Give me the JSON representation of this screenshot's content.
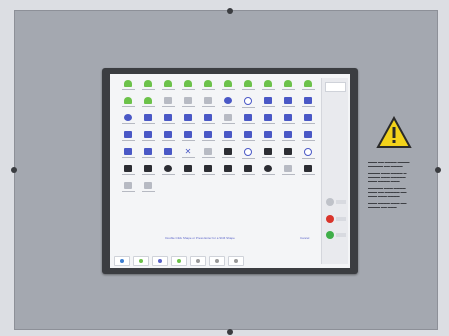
{
  "screen": {
    "hint_text": "Double Click Shape or Press Enter for a Shift Shape",
    "hint_right": "Cancel",
    "icon_rows": [
      [
        "g",
        "g",
        "g",
        "g",
        "g",
        "g",
        "g",
        "g",
        "g",
        "g"
      ],
      [
        "g",
        "g",
        "gy",
        "gy",
        "gy",
        "bc",
        "r",
        "b",
        "b",
        "b"
      ],
      [
        "bc",
        "b",
        "b",
        "b",
        "b",
        "gy",
        "b",
        "b",
        "b",
        "b"
      ],
      [
        "b",
        "b",
        "b",
        "b",
        "b",
        "b",
        "b",
        "b",
        "b",
        "b"
      ],
      [
        "b",
        "b",
        "b",
        "cross",
        "gy",
        "k",
        "r",
        "k",
        "k",
        "r"
      ],
      [
        "k",
        "k",
        "kc",
        "k",
        "k",
        "k",
        "k",
        "kc",
        "gy",
        "k"
      ],
      [
        "gy",
        "gy",
        "",
        "",
        "",
        "",
        "",
        "",
        "",
        ""
      ]
    ],
    "taskbar_dots": [
      "#3d7fd1",
      "#6cc24a",
      "#5a63c8",
      "#6cc24a",
      "#999999",
      "#999999",
      "#999999"
    ]
  },
  "sidebar": {
    "buttons": [
      {
        "color": "#bfc2c9"
      },
      {
        "color": "#d9342b"
      },
      {
        "color": "#3fae49"
      }
    ]
  },
  "colors": {
    "panel": "#a4a8b0",
    "bezel": "#3b3d41",
    "warning_yellow": "#f2d21b"
  },
  "warning_sign": {
    "icon": "warning-triangle-icon"
  }
}
